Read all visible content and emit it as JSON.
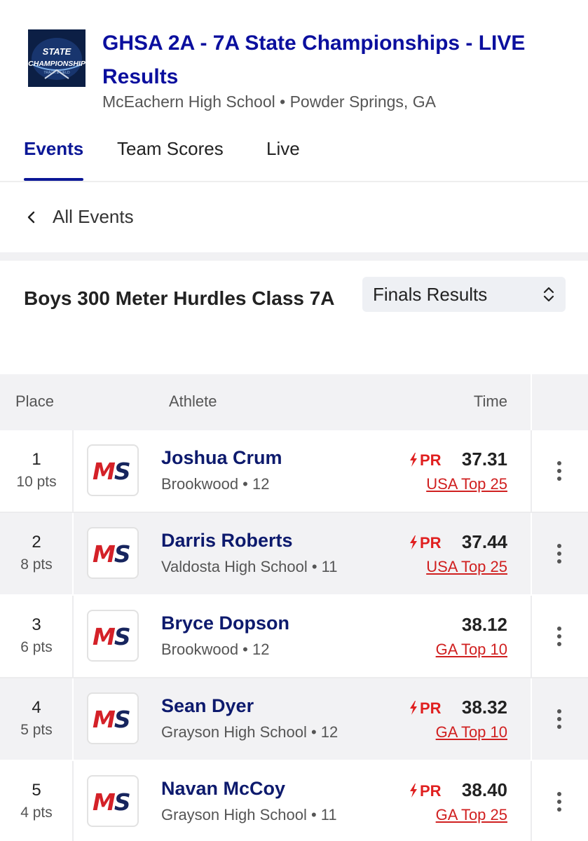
{
  "meet": {
    "title": "GHSA 2A - 7A State Championships - LIVE Results",
    "location": "McEachern High School • Powder Springs, GA",
    "logo_text": "STATE CHAMPIONSHIP"
  },
  "tabs": [
    {
      "label": "Events",
      "active": true
    },
    {
      "label": "Team Scores",
      "active": false
    },
    {
      "label": "Live",
      "active": false
    }
  ],
  "nav": {
    "back_label": "All Events"
  },
  "event": {
    "title": "Boys 300 Meter Hurdles Class 7A",
    "round_select": "Finals Results"
  },
  "table": {
    "headers": {
      "place": "Place",
      "athlete": "Athlete",
      "time": "Time"
    },
    "rows": [
      {
        "place": "1",
        "points": "10 pts",
        "name": "Joshua Crum",
        "school": "Brookwood • 12",
        "pr": "PR",
        "mark": "37.31",
        "rank": "USA Top 25"
      },
      {
        "place": "2",
        "points": "8 pts",
        "name": "Darris Roberts",
        "school": "Valdosta High School • 11",
        "pr": "PR",
        "mark": "37.44",
        "rank": "USA Top 25"
      },
      {
        "place": "3",
        "points": "6 pts",
        "name": "Bryce Dopson",
        "school": "Brookwood • 12",
        "pr": "",
        "mark": "38.12",
        "rank": "GA Top 10"
      },
      {
        "place": "4",
        "points": "5 pts",
        "name": "Sean Dyer",
        "school": "Grayson High School • 12",
        "pr": "PR",
        "mark": "38.32",
        "rank": "GA Top 10"
      },
      {
        "place": "5",
        "points": "4 pts",
        "name": "Navan McCoy",
        "school": "Grayson High School • 11",
        "pr": "PR",
        "mark": "38.40",
        "rank": "GA Top 25"
      }
    ]
  },
  "team_logo": {
    "left": "M",
    "right": "S"
  },
  "colors": {
    "brand_blue": "#0b1796",
    "pr_red": "#e02020",
    "link_red": "#d02020",
    "athlete_blue": "#0d1a6d"
  }
}
